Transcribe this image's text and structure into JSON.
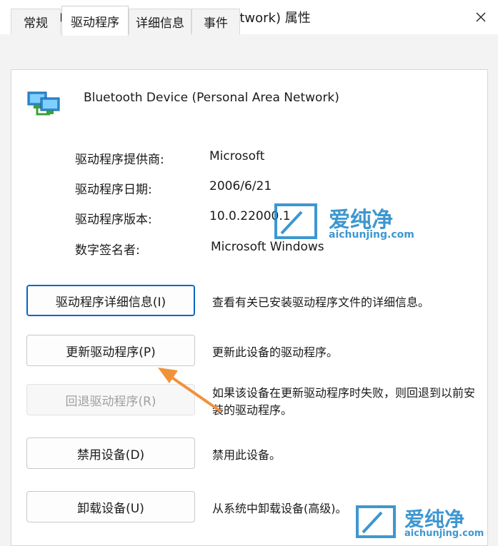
{
  "window": {
    "title": "Bluetooth Device (Personal Area Network) 属性"
  },
  "tabs": [
    {
      "label": "常规"
    },
    {
      "label": "驱动程序"
    },
    {
      "label": "详细信息"
    },
    {
      "label": "事件"
    }
  ],
  "device": {
    "name": "Bluetooth Device (Personal Area Network)",
    "icon": "network-adapter-icon"
  },
  "fields": [
    {
      "label": "驱动程序提供商:",
      "value": "Microsoft"
    },
    {
      "label": "驱动程序日期:",
      "value": "2006/6/21"
    },
    {
      "label": "驱动程序版本:",
      "value": "10.0.22000.1"
    },
    {
      "label": "数字签名者:",
      "value": "Microsoft Windows"
    }
  ],
  "actions": [
    {
      "button": "驱动程序详细信息(I)",
      "description": "查看有关已安装驱动程序文件的详细信息。"
    },
    {
      "button": "更新驱动程序(P)",
      "description": "更新此设备的驱动程序。"
    },
    {
      "button": "回退驱动程序(R)",
      "description": "如果该设备在更新驱动程序时失败，则回退到以前安装的驱动程序。"
    },
    {
      "button": "禁用设备(D)",
      "description": "禁用此设备。"
    },
    {
      "button": "卸载设备(U)",
      "description": "从系统中卸载设备(高级)。"
    }
  ],
  "watermark": {
    "brand": "爱纯净",
    "site": "aichunjing.com"
  },
  "colors": {
    "accent": "#0067c0",
    "arrow": "#f0923a",
    "watermark": "#1c86c8"
  }
}
